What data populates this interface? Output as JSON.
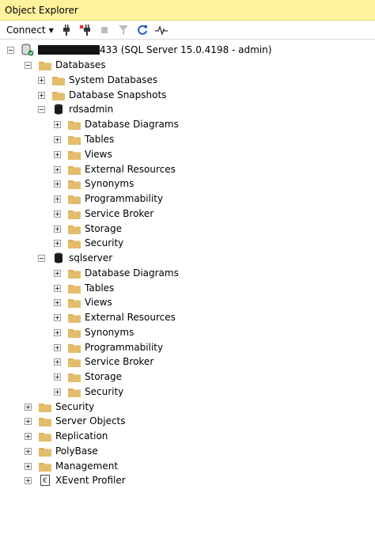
{
  "panel": {
    "title": "Object Explorer"
  },
  "toolbar": {
    "connect_label": "Connect",
    "icons": [
      "connect-plug-icon",
      "disconnect-icon",
      "stop-icon",
      "filter-icon",
      "refresh-icon",
      "activity-monitor-icon"
    ]
  },
  "server": {
    "label_suffix": "433 (SQL Server 15.0.4198 - admin)"
  },
  "tree": {
    "databases": "Databases",
    "system_databases": "System Databases",
    "database_snapshots": "Database Snapshots",
    "db1": {
      "name": "rdsadmin",
      "children": [
        "Database Diagrams",
        "Tables",
        "Views",
        "External Resources",
        "Synonyms",
        "Programmability",
        "Service Broker",
        "Storage",
        "Security"
      ]
    },
    "db2": {
      "name": "sqlserver",
      "children": [
        "Database Diagrams",
        "Tables",
        "Views",
        "External Resources",
        "Synonyms",
        "Programmability",
        "Service Broker",
        "Storage",
        "Security"
      ]
    },
    "top_level": [
      "Security",
      "Server Objects",
      "Replication",
      "PolyBase",
      "Management",
      "XEvent Profiler"
    ]
  },
  "colors": {
    "title_bg": "#fff29d",
    "folder": "#dcb05b",
    "folder_dark": "#c89a3e"
  }
}
